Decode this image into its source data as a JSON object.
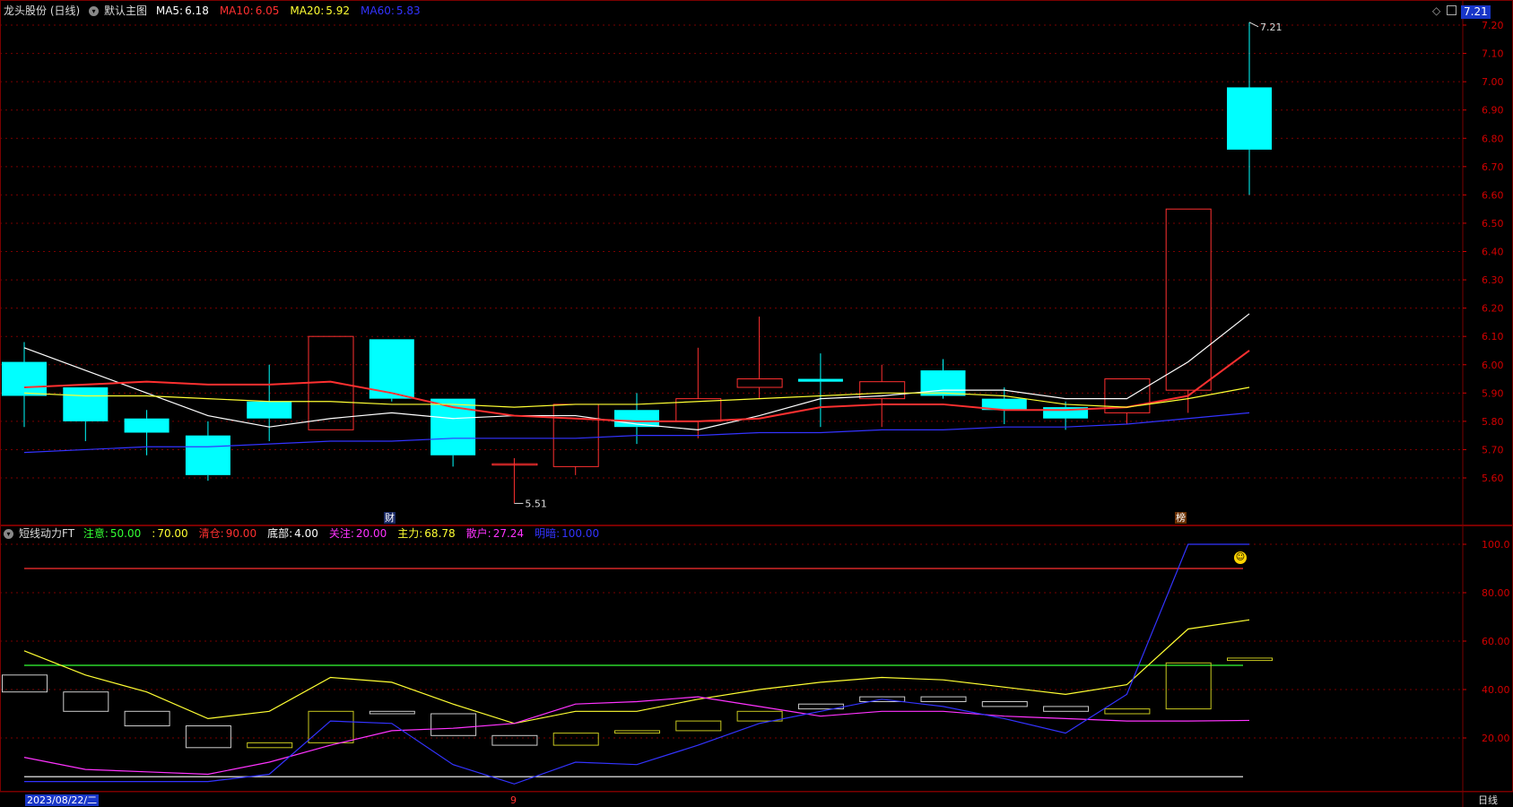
{
  "header_main": {
    "stock": "龙头股份 (日线)",
    "template": "默认主图",
    "ma": [
      {
        "label": "MA5:",
        "value": "6.18",
        "color": "#ffffff"
      },
      {
        "label": "MA10:",
        "value": "6.05",
        "color": "#ff3030"
      },
      {
        "label": "MA20:",
        "value": "5.92",
        "color": "#ffff33"
      },
      {
        "label": "MA60:",
        "value": "5.83",
        "color": "#3333ff"
      }
    ]
  },
  "header_sub": {
    "indicator": "短线动力FT",
    "params": [
      {
        "label": "注意:",
        "value": "50.00",
        "color": "#33ff33"
      },
      {
        "label": ":",
        "value": "70.00",
        "color": "#ffff33"
      },
      {
        "label": "清仓:",
        "value": "90.00",
        "color": "#ff3030"
      },
      {
        "label": "底部:",
        "value": "4.00",
        "color": "#ffffff"
      },
      {
        "label": "关注:",
        "value": "20.00",
        "color": "#ff33ff"
      },
      {
        "label": "主力:",
        "value": "68.78",
        "color": "#ffff33"
      },
      {
        "label": "散户:",
        "value": "27.24",
        "color": "#ff33ff"
      },
      {
        "label": "明暗:",
        "value": "100.00",
        "color": "#3333ff"
      }
    ]
  },
  "price_axis": [
    "7.20",
    "7.10",
    "7.00",
    "6.90",
    "6.80",
    "6.70",
    "6.60",
    "6.50",
    "6.40",
    "6.30",
    "6.20",
    "6.10",
    "6.00",
    "5.90",
    "5.80",
    "5.70",
    "5.60"
  ],
  "sub_axis": [
    "100.0",
    "80.00",
    "60.00",
    "40.00",
    "20.00"
  ],
  "current_price": "7.21",
  "high_label": "7.21",
  "low_label": "5.51",
  "date_label": "2023/08/22/二",
  "bottom_marker": "9",
  "period_label": "日线",
  "events": [
    {
      "label": "财"
    },
    {
      "label": "榜"
    }
  ],
  "colors": {
    "up": "#ff3030",
    "down": "#00ffff",
    "grid": "#7a0000"
  },
  "chart_data": [
    {
      "type": "candlestick",
      "title": "龙头股份 (日线)",
      "ylim": [
        5.5,
        7.25
      ],
      "candles": [
        {
          "o": 6.01,
          "h": 6.08,
          "l": 5.78,
          "c": 5.89
        },
        {
          "o": 5.92,
          "h": 5.92,
          "l": 5.73,
          "c": 5.8
        },
        {
          "o": 5.81,
          "h": 5.84,
          "l": 5.68,
          "c": 5.76
        },
        {
          "o": 5.75,
          "h": 5.8,
          "l": 5.59,
          "c": 5.61
        },
        {
          "o": 5.87,
          "h": 6.0,
          "l": 5.73,
          "c": 5.81
        },
        {
          "o": 5.77,
          "h": 6.1,
          "l": 5.77,
          "c": 6.1
        },
        {
          "o": 6.09,
          "h": 6.09,
          "l": 5.87,
          "c": 5.88
        },
        {
          "o": 5.88,
          "h": 5.88,
          "l": 5.64,
          "c": 5.68
        },
        {
          "o": 5.65,
          "h": 5.67,
          "l": 5.51,
          "c": 5.65
        },
        {
          "o": 5.64,
          "h": 5.86,
          "l": 5.61,
          "c": 5.86
        },
        {
          "o": 5.84,
          "h": 5.9,
          "l": 5.72,
          "c": 5.78
        },
        {
          "o": 5.8,
          "h": 6.06,
          "l": 5.74,
          "c": 5.88
        },
        {
          "o": 5.92,
          "h": 6.17,
          "l": 5.88,
          "c": 5.95
        },
        {
          "o": 5.95,
          "h": 6.04,
          "l": 5.78,
          "c": 5.94
        },
        {
          "o": 5.88,
          "h": 6.0,
          "l": 5.78,
          "c": 5.94
        },
        {
          "o": 5.98,
          "h": 6.02,
          "l": 5.88,
          "c": 5.89
        },
        {
          "o": 5.88,
          "h": 5.92,
          "l": 5.79,
          "c": 5.84
        },
        {
          "o": 5.85,
          "h": 5.87,
          "l": 5.77,
          "c": 5.81
        },
        {
          "o": 5.83,
          "h": 5.95,
          "l": 5.79,
          "c": 5.95
        },
        {
          "o": 5.91,
          "h": 6.55,
          "l": 5.83,
          "c": 6.55
        },
        {
          "o": 6.98,
          "h": 7.21,
          "l": 6.6,
          "c": 6.76
        }
      ],
      "series": [
        {
          "name": "MA5",
          "color": "#ffffff",
          "values": [
            6.06,
            5.98,
            5.9,
            5.82,
            5.78,
            5.81,
            5.83,
            5.81,
            5.82,
            5.82,
            5.79,
            5.77,
            5.82,
            5.88,
            5.89,
            5.91,
            5.91,
            5.88,
            5.88,
            6.01,
            6.18
          ]
        },
        {
          "name": "MA10",
          "color": "#ff3030",
          "values": [
            5.92,
            5.93,
            5.94,
            5.93,
            5.93,
            5.94,
            5.9,
            5.85,
            5.82,
            5.81,
            5.8,
            5.8,
            5.81,
            5.85,
            5.86,
            5.86,
            5.84,
            5.84,
            5.85,
            5.89,
            6.05
          ]
        },
        {
          "name": "MA20",
          "color": "#ffff33",
          "values": [
            5.9,
            5.89,
            5.89,
            5.88,
            5.87,
            5.87,
            5.86,
            5.86,
            5.85,
            5.86,
            5.86,
            5.87,
            5.88,
            5.89,
            5.9,
            5.9,
            5.89,
            5.86,
            5.85,
            5.88,
            5.92
          ]
        },
        {
          "name": "MA60",
          "color": "#3333ff",
          "values": [
            5.69,
            5.7,
            5.71,
            5.71,
            5.72,
            5.73,
            5.73,
            5.74,
            5.74,
            5.74,
            5.75,
            5.75,
            5.76,
            5.76,
            5.77,
            5.77,
            5.78,
            5.78,
            5.79,
            5.81,
            5.83
          ]
        }
      ]
    },
    {
      "type": "line",
      "title": "短线动力FT",
      "ylim": [
        0,
        105
      ],
      "series": [
        {
          "name": "主力",
          "color": "#ffff33",
          "values": [
            56,
            46,
            39,
            28,
            31,
            45,
            43,
            34,
            26,
            31,
            31,
            36,
            40,
            43,
            45,
            44,
            41,
            38,
            42,
            65,
            68.78
          ]
        },
        {
          "name": "散户",
          "color": "#ff33ff",
          "values": [
            12,
            7,
            6,
            5,
            10,
            17,
            23,
            24,
            26,
            34,
            35,
            37,
            33,
            29,
            31,
            31,
            29,
            28,
            27,
            27,
            27.24
          ]
        },
        {
          "name": "明暗",
          "color": "#3333ff",
          "values": [
            2,
            2,
            2,
            2,
            5,
            27,
            26,
            9,
            1,
            10,
            9,
            17,
            26,
            31,
            36,
            33,
            28,
            22,
            38,
            100,
            100
          ]
        }
      ],
      "bars": [
        {
          "top": 46,
          "bottom": 39
        },
        {
          "top": 39,
          "bottom": 31
        },
        {
          "top": 31,
          "bottom": 25
        },
        {
          "top": 25,
          "bottom": 16
        },
        {
          "top": 18,
          "bottom": 16
        },
        {
          "top": 31,
          "bottom": 18
        },
        {
          "top": 31,
          "bottom": 30
        },
        {
          "top": 30,
          "bottom": 21
        },
        {
          "top": 21,
          "bottom": 17
        },
        {
          "top": 22,
          "bottom": 17
        },
        {
          "top": 23,
          "bottom": 22
        },
        {
          "top": 27,
          "bottom": 23
        },
        {
          "top": 31,
          "bottom": 27
        },
        {
          "top": 34,
          "bottom": 32
        },
        {
          "top": 37,
          "bottom": 35
        },
        {
          "top": 37,
          "bottom": 35
        },
        {
          "top": 35,
          "bottom": 33
        },
        {
          "top": 33,
          "bottom": 31
        },
        {
          "top": 32,
          "bottom": 30
        },
        {
          "top": 51,
          "bottom": 32
        },
        {
          "top": 53,
          "bottom": 52
        }
      ],
      "bar_colors": [
        "#cccccc",
        "#cccccc",
        "#cccccc",
        "#cccccc",
        "#c8c820",
        "#c8c820",
        "#cccccc",
        "#cccccc",
        "#cccccc",
        "#c8c820",
        "#c8c820",
        "#c8c820",
        "#c8c820",
        "#cccccc",
        "#cccccc",
        "#cccccc",
        "#cccccc",
        "#cccccc",
        "#c8c820",
        "#c8c820",
        "#c8c820"
      ],
      "hlines": [
        {
          "value": 90,
          "color": "#ff3030"
        },
        {
          "value": 50,
          "color": "#33ff33"
        },
        {
          "value": 4,
          "color": "#ffffff"
        }
      ]
    }
  ]
}
